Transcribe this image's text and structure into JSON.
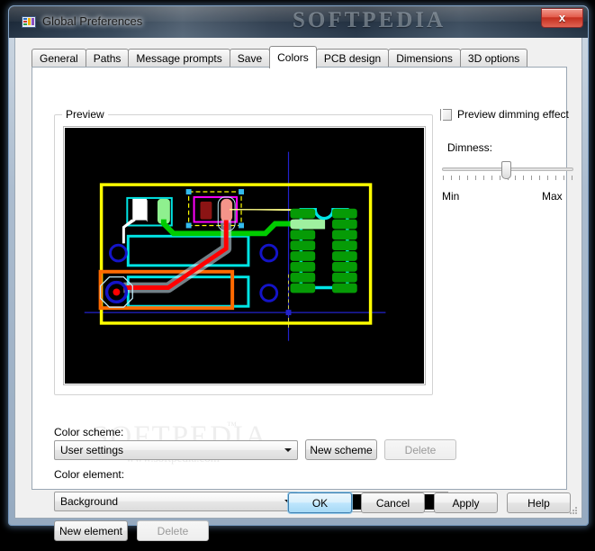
{
  "window": {
    "title": "Global Preferences",
    "icon": "app-preferences-icon",
    "close_label": "x",
    "desktop_watermark": "SOFTPEDIA"
  },
  "tabs": [
    {
      "label": "General",
      "selected": false
    },
    {
      "label": "Paths",
      "selected": false
    },
    {
      "label": "Message prompts",
      "selected": false
    },
    {
      "label": "Save",
      "selected": false
    },
    {
      "label": "Colors",
      "selected": true
    },
    {
      "label": "PCB design",
      "selected": false
    },
    {
      "label": "Dimensions",
      "selected": false
    },
    {
      "label": "3D options",
      "selected": false
    }
  ],
  "preview": {
    "group_label": "Preview",
    "background_color": "#000000",
    "board_outline_color": "#ffff00",
    "silkscreen_color": "#00ffff",
    "pad_green_color": "#00a000",
    "pad_green_highlight_color": "#90ee90",
    "track_red_color": "#ff0000",
    "track_green_color": "#00cc00",
    "via_color": "#0000cc",
    "keepout_color": "#ff6600",
    "selection_color": "#ff00ff",
    "ratsnest_color": "#ffff99"
  },
  "dimming": {
    "checkbox_label": "Preview dimming effect",
    "checked": false,
    "slider_label": "Dimness:",
    "min_label": "Min",
    "max_label": "Max",
    "value_percent": 47,
    "tick_count": 17
  },
  "color_scheme": {
    "label": "Color scheme:",
    "selected": "User settings",
    "new_button": "New scheme",
    "delete_button": "Delete",
    "delete_enabled": false
  },
  "color_element": {
    "label": "Color element:",
    "selected": "Background",
    "swatch_color": "#000000",
    "new_button": "New element",
    "delete_button": "Delete",
    "delete_enabled": false
  },
  "footer": {
    "ok": "OK",
    "cancel": "Cancel",
    "apply": "Apply",
    "help": "Help"
  },
  "body_watermark": {
    "main": "SOFTPEDIA",
    "sub": "www.softpedia.com",
    "tm": "™"
  }
}
